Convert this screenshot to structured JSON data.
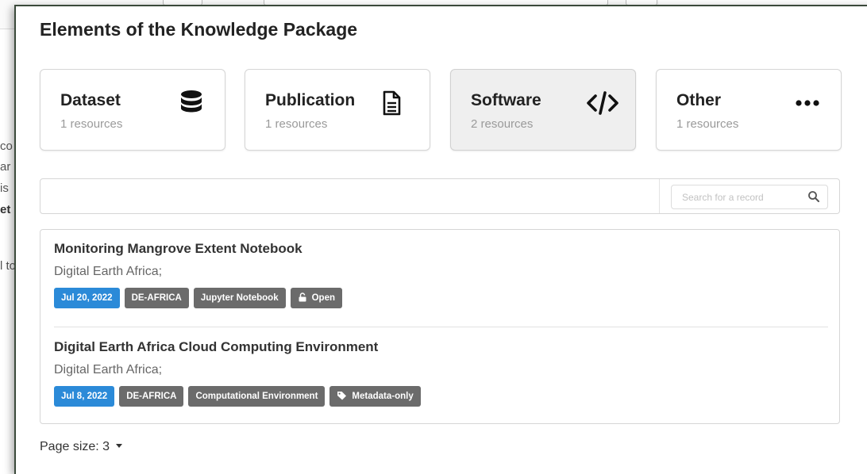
{
  "background": {
    "text_fragments": [
      "co",
      "ar",
      "is",
      "et",
      "l to"
    ]
  },
  "modal": {
    "title": "Elements of the Knowledge Package"
  },
  "categories": [
    {
      "title": "Dataset",
      "count": "1 resources",
      "icon": "database-icon"
    },
    {
      "title": "Publication",
      "count": "1 resources",
      "icon": "document-icon"
    },
    {
      "title": "Software",
      "count": "2 resources",
      "icon": "code-icon",
      "active": true
    },
    {
      "title": "Other",
      "count": "1 resources",
      "icon": "ellipsis-icon"
    }
  ],
  "search": {
    "placeholder": "Search for a record",
    "icon": "search-icon"
  },
  "records": [
    {
      "title": "Monitoring Mangrove Extent Notebook",
      "author": "Digital Earth Africa;",
      "date": "Jul 20, 2022",
      "community": "DE-AFRICA",
      "type": "Jupyter Notebook",
      "access": "Open",
      "access_icon": "lock-open-icon"
    },
    {
      "title": "Digital Earth Africa Cloud Computing Environment",
      "author": "Digital Earth Africa;",
      "date": "Jul 8, 2022",
      "community": "DE-AFRICA",
      "type": "Computational Environment",
      "access": "Metadata-only",
      "access_icon": "tag-icon"
    }
  ],
  "pagination": {
    "label": "Page size: 3"
  },
  "colors": {
    "date_badge": "#2b8ad8",
    "badge": "#6b6b6b",
    "active_card": "#efefef"
  }
}
